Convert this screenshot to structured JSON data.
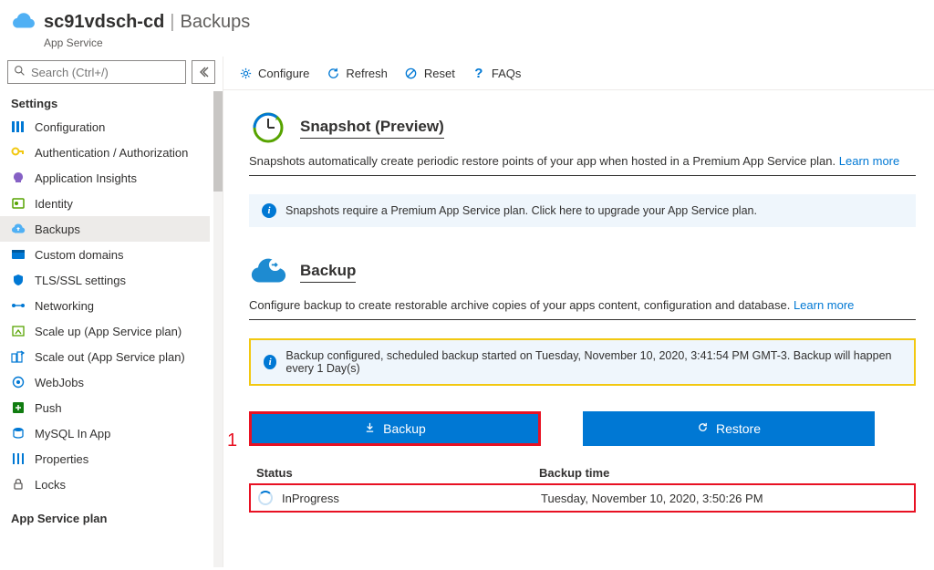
{
  "header": {
    "resource_name": "sc91vdsch-cd",
    "page_name": "Backups",
    "resource_type": "App Service"
  },
  "search": {
    "placeholder": "Search (Ctrl+/)"
  },
  "sidebar": {
    "section_settings": "Settings",
    "section_appserviceplan": "App Service plan",
    "items": {
      "configuration": "Configuration",
      "auth": "Authentication / Authorization",
      "appinsights": "Application Insights",
      "identity": "Identity",
      "backups": "Backups",
      "customdomains": "Custom domains",
      "tlsssl": "TLS/SSL settings",
      "networking": "Networking",
      "scaleup": "Scale up (App Service plan)",
      "scaleout": "Scale out (App Service plan)",
      "webjobs": "WebJobs",
      "push": "Push",
      "mysql": "MySQL In App",
      "properties": "Properties",
      "locks": "Locks"
    }
  },
  "toolbar": {
    "configure": "Configure",
    "refresh": "Refresh",
    "reset": "Reset",
    "faqs": "FAQs"
  },
  "snapshot": {
    "title": "Snapshot (Preview)",
    "desc": "Snapshots automatically create periodic restore points of your app when hosted in a Premium App Service plan. ",
    "learn_more": "Learn more",
    "info": "Snapshots require a Premium App Service plan. Click here to upgrade your App Service plan."
  },
  "backup": {
    "title": "Backup",
    "desc": "Configure backup to create restorable archive copies of your apps content, configuration and database. ",
    "learn_more": "Learn more",
    "info": "Backup configured, scheduled backup started on Tuesday, November 10, 2020, 3:41:54 PM GMT-3. Backup will happen every 1 Day(s)",
    "backup_btn": "Backup",
    "restore_btn": "Restore"
  },
  "table": {
    "col_status": "Status",
    "col_backup_time": "Backup time",
    "rows": [
      {
        "status": "InProgress",
        "time": "Tuesday, November 10, 2020, 3:50:26 PM"
      }
    ]
  },
  "annotations": {
    "one": "1"
  }
}
